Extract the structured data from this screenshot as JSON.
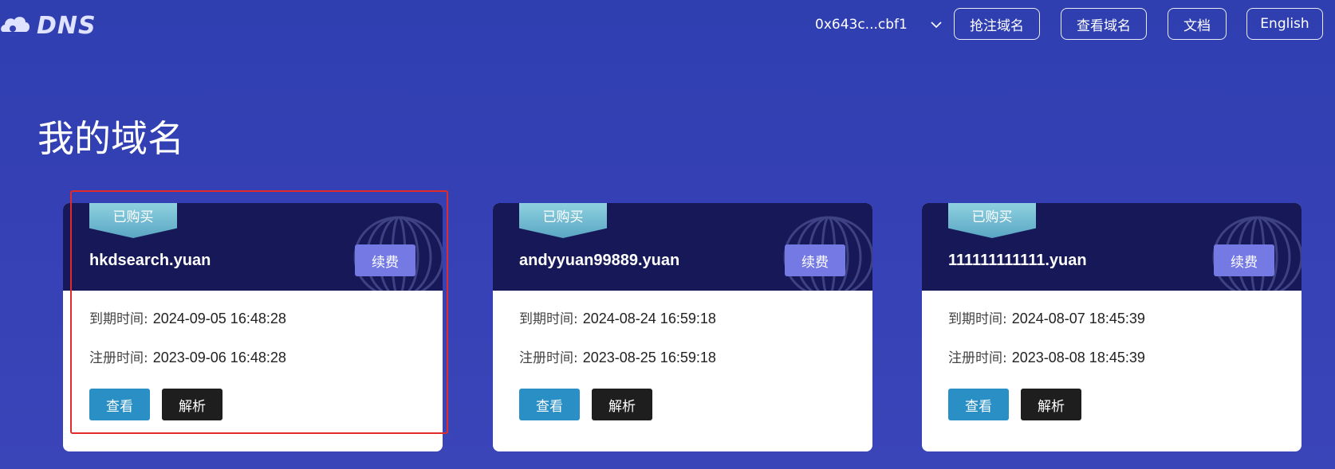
{
  "header": {
    "logo_text": "DNS",
    "wallet_address": "0x643c...cbf1",
    "nav": [
      "抢注域名",
      "查看域名",
      "文档",
      "English"
    ]
  },
  "page_title": "我的域名",
  "labels": {
    "badge": "已购买",
    "renew": "续费",
    "expire_label": "到期时间:",
    "register_label": "注册时间:",
    "view": "查看",
    "parse": "解析"
  },
  "cards": [
    {
      "domain": "hkdsearch.yuan",
      "expire": "2024-09-05 16:48:28",
      "register": "2023-09-06 16:48:28"
    },
    {
      "domain": "andyyuan99889.yuan",
      "expire": "2024-08-24 16:59:18",
      "register": "2023-08-25 16:59:18"
    },
    {
      "domain": "111111111111.yuan",
      "expire": "2024-08-07 18:45:39",
      "register": "2023-08-08 18:45:39"
    }
  ],
  "colors": {
    "background": "#3440b4",
    "card_header": "#161857",
    "renew_button": "#7479e4",
    "view_button": "#2a8fc4",
    "parse_button": "#1e1e1e",
    "highlight_border": "#e02b2b"
  },
  "icons": [
    "cloud-logo-icon",
    "chevron-down-icon",
    "sphere-decoration-icon"
  ]
}
